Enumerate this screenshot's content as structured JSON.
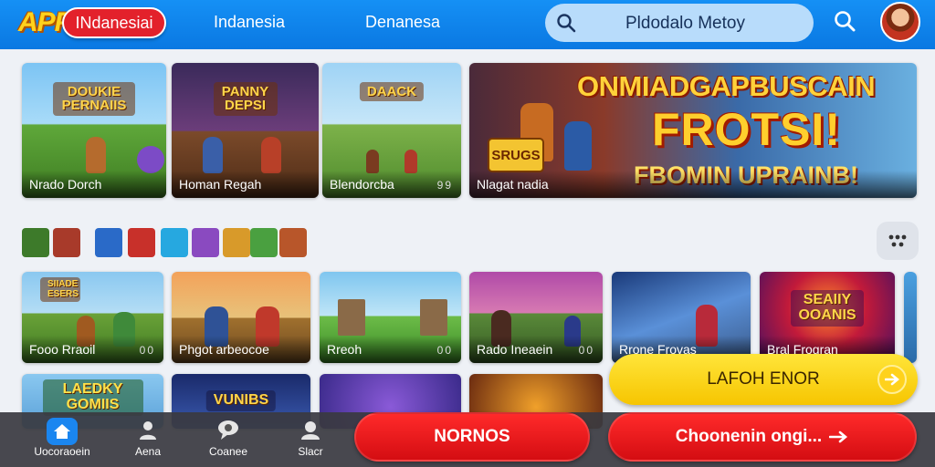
{
  "header": {
    "logo": "APP",
    "language": "INdanesiai",
    "nav": [
      "Indanesia",
      "Denanesa"
    ],
    "search_value": "Pldodalo Metoy"
  },
  "featured": [
    {
      "art_title": "DOUKIE PERNAIIS",
      "caption": "Nrado Dorch"
    },
    {
      "art_title": "PANNY DEPSI",
      "caption": "Homan Regah"
    },
    {
      "art_title": "DAACK",
      "caption": "Blendorcba",
      "dots": "99"
    }
  ],
  "banner": {
    "line1": "ONMIADGAPBUSCAIN",
    "line2": "FROTSI!",
    "line3": "FBOMIN UPRAINB!",
    "badge": "SRUGS",
    "caption": "Nlagat nadia"
  },
  "row2": [
    {
      "art_title": "SIIADE ESERS",
      "caption": "Fooo Rraoil",
      "dots": "00"
    },
    {
      "art_title": "",
      "caption": "Phgot arbeocoe"
    },
    {
      "art_title": "",
      "caption": "Rreoh",
      "dots": "00"
    },
    {
      "art_title": "",
      "caption": "Rado Ineaein",
      "dots": "00"
    },
    {
      "art_title": "",
      "caption": "Rrone Frovas"
    },
    {
      "art_title": "SEAIIY OOANIS",
      "caption": "Bral Frogran"
    }
  ],
  "row3": [
    {
      "art_title": "LAEDKY GOMIIS"
    },
    {
      "art_title": "VUNIBS"
    },
    {
      "art_title": ""
    },
    {
      "art_title": ""
    }
  ],
  "bottom_nav": [
    {
      "label": "Uocoraoein",
      "icon": "home-icon"
    },
    {
      "label": "Aena",
      "icon": "user-icon"
    },
    {
      "label": "Coanee",
      "icon": "chat-icon"
    },
    {
      "label": "Slacr",
      "icon": "profile-icon"
    }
  ],
  "buttons": {
    "nornos": "NORNOS",
    "choose": "Choonenin ongi...",
    "launch": "LAFOH ENOR"
  },
  "colors": {
    "header": "#0a78e2",
    "accent_red": "#e3212b",
    "accent_yellow": "#f6c500"
  }
}
